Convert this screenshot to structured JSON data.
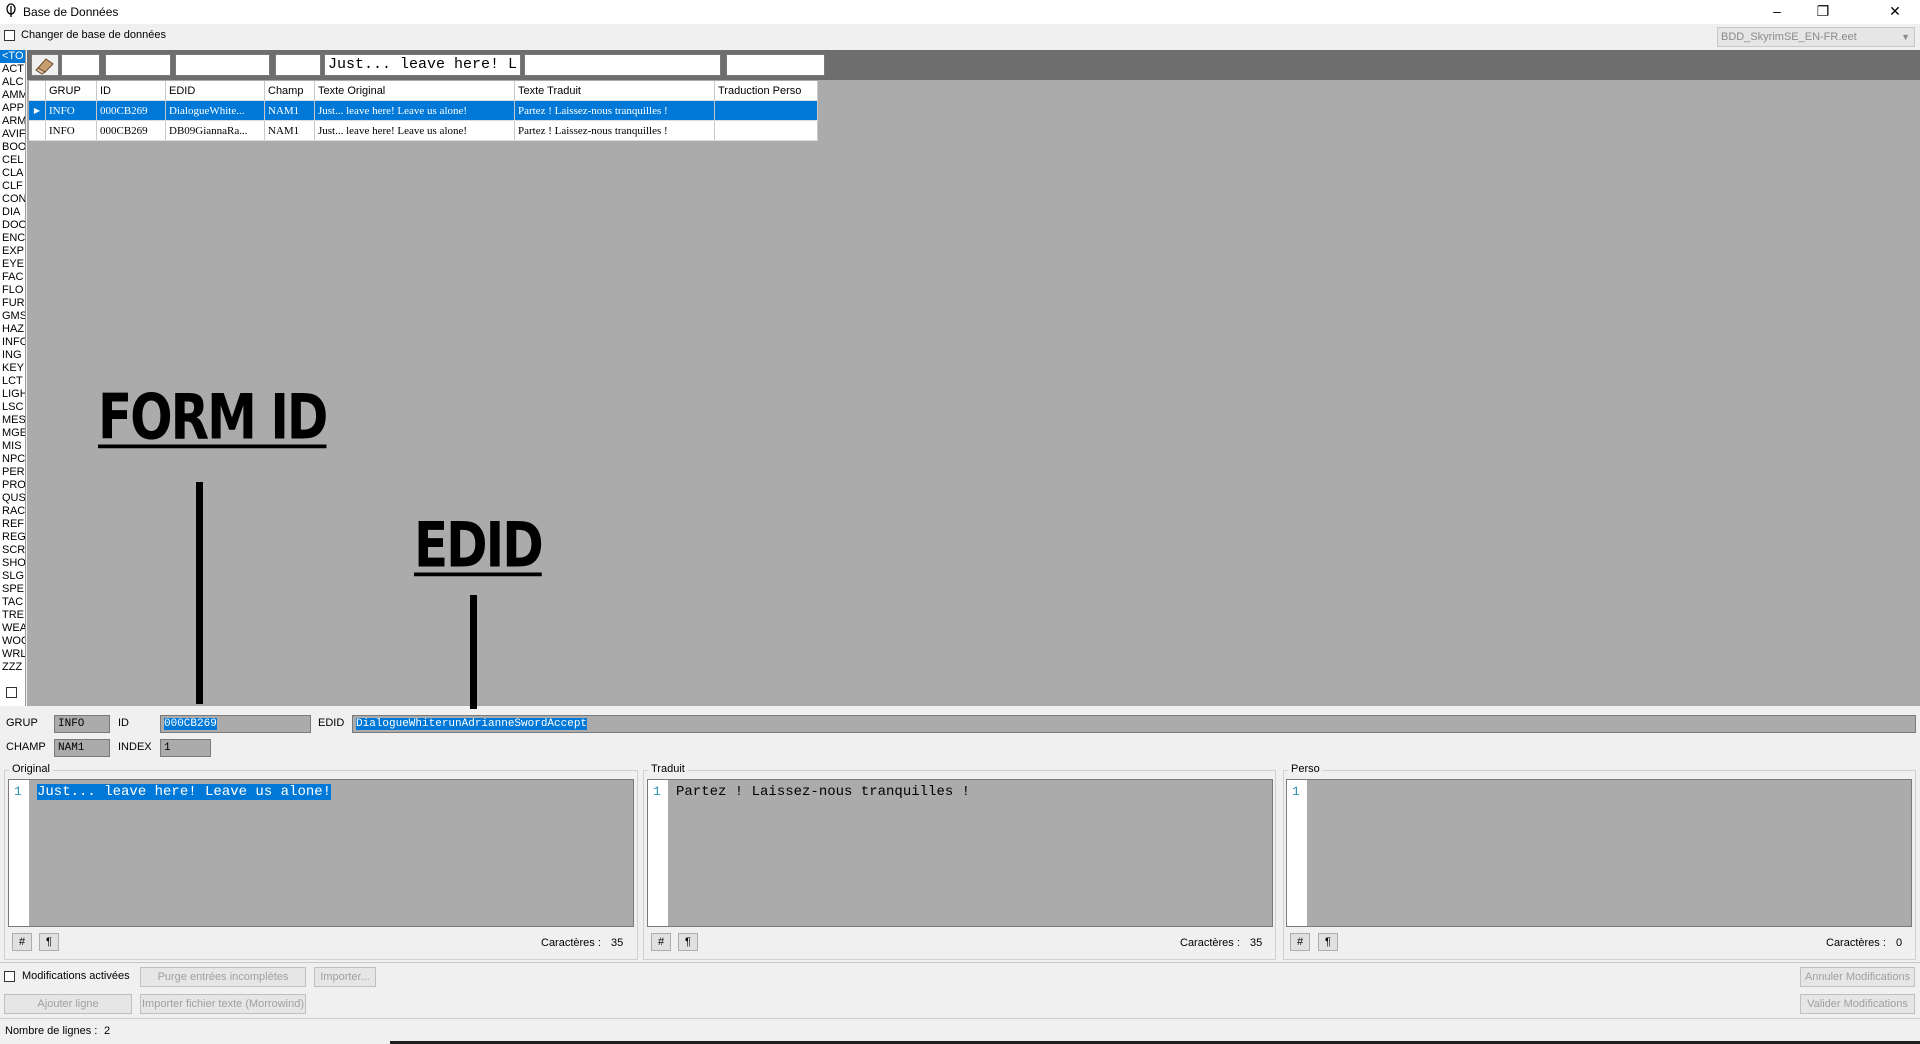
{
  "window": {
    "title": "Base de Données",
    "minimize_symbol": "–",
    "restore_symbol": "❐",
    "close_symbol": "✕"
  },
  "top": {
    "change_db_label": "Changer de base de données",
    "db_selected": "BDD_SkyrimSE_EN-FR.eet"
  },
  "record_types": [
    "<TO",
    "ACT",
    "ALC",
    "AMM",
    "APP",
    "ARM",
    "AVIF",
    "BOO",
    "CEL",
    "CLA",
    "CLF",
    "CON",
    "DIA",
    "DOO",
    "ENC",
    "EXP",
    "EYE",
    "FAC",
    "FLO",
    "FUR",
    "GMS",
    "HAZ",
    "INFO",
    "ING",
    "KEY",
    "LCT",
    "LIGH",
    "LSC",
    "MES",
    "MGE",
    "MIS",
    "NPC",
    "PER",
    "PRO",
    "QUS",
    "RAC",
    "REF",
    "REG",
    "SCR",
    "SHO",
    "SLG",
    "SPE",
    "TAC",
    "TRE",
    "WEA",
    "WOO",
    "WRL",
    "ZZZ"
  ],
  "filter": {
    "texte_original": "Just... leave here! L"
  },
  "grid": {
    "columns": [
      "GRUP",
      "ID",
      "EDID",
      "Champ",
      "Texte Original",
      "Texte Traduit",
      "Traduction Perso"
    ],
    "rows": [
      {
        "grup": "INFO",
        "id": "000CB269",
        "edid": "DialogueWhite...",
        "champ": "NAM1",
        "original": "Just... leave here! Leave us alone!",
        "traduit": "Partez ! Laissez-nous tranquilles !",
        "perso": ""
      },
      {
        "grup": "INFO",
        "id": "000CB269",
        "edid": "DB09GiannaRa...",
        "champ": "NAM1",
        "original": "Just... leave here! Leave us alone!",
        "traduit": "Partez ! Laissez-nous tranquilles !",
        "perso": ""
      }
    ]
  },
  "annotations": {
    "form_id": "FORM ID",
    "edid": "EDID"
  },
  "detail": {
    "grup_label": "GRUP",
    "grup_value": "INFO",
    "id_label": "ID",
    "id_value": "000CB269",
    "edid_label": "EDID",
    "edid_value": "DialogueWhiterunAdrianneSwordAccept",
    "champ_label": "CHAMP",
    "champ_value": "NAM1",
    "index_label": "INDEX",
    "index_value": "1"
  },
  "editors": {
    "original": {
      "label": "Original",
      "line": "1",
      "text": "Just... leave here! Leave us alone!",
      "chars_label": "Caractères :",
      "chars": "35"
    },
    "traduit": {
      "label": "Traduit",
      "line": "1",
      "text": "Partez ! Laissez-nous tranquilles !",
      "chars_label": "Caractères :",
      "chars": "35"
    },
    "perso": {
      "label": "Perso",
      "line": "1",
      "text": "",
      "chars_label": "Caractères :",
      "chars": "0"
    },
    "hash_symbol": "#",
    "pilcrow_symbol": "¶"
  },
  "actions": {
    "modifications_label": "Modifications activées",
    "purge": "Purge entrées incomplètes",
    "importer": "Importer...",
    "ajouter_ligne": "Ajouter ligne",
    "importer_fichier": "Importer fichier texte (Morrowind)",
    "annuler": "Annuler Modifications",
    "valider": "Valider Modifications"
  },
  "status": {
    "lines_label": "Nombre de lignes :",
    "lines_count": "2"
  }
}
